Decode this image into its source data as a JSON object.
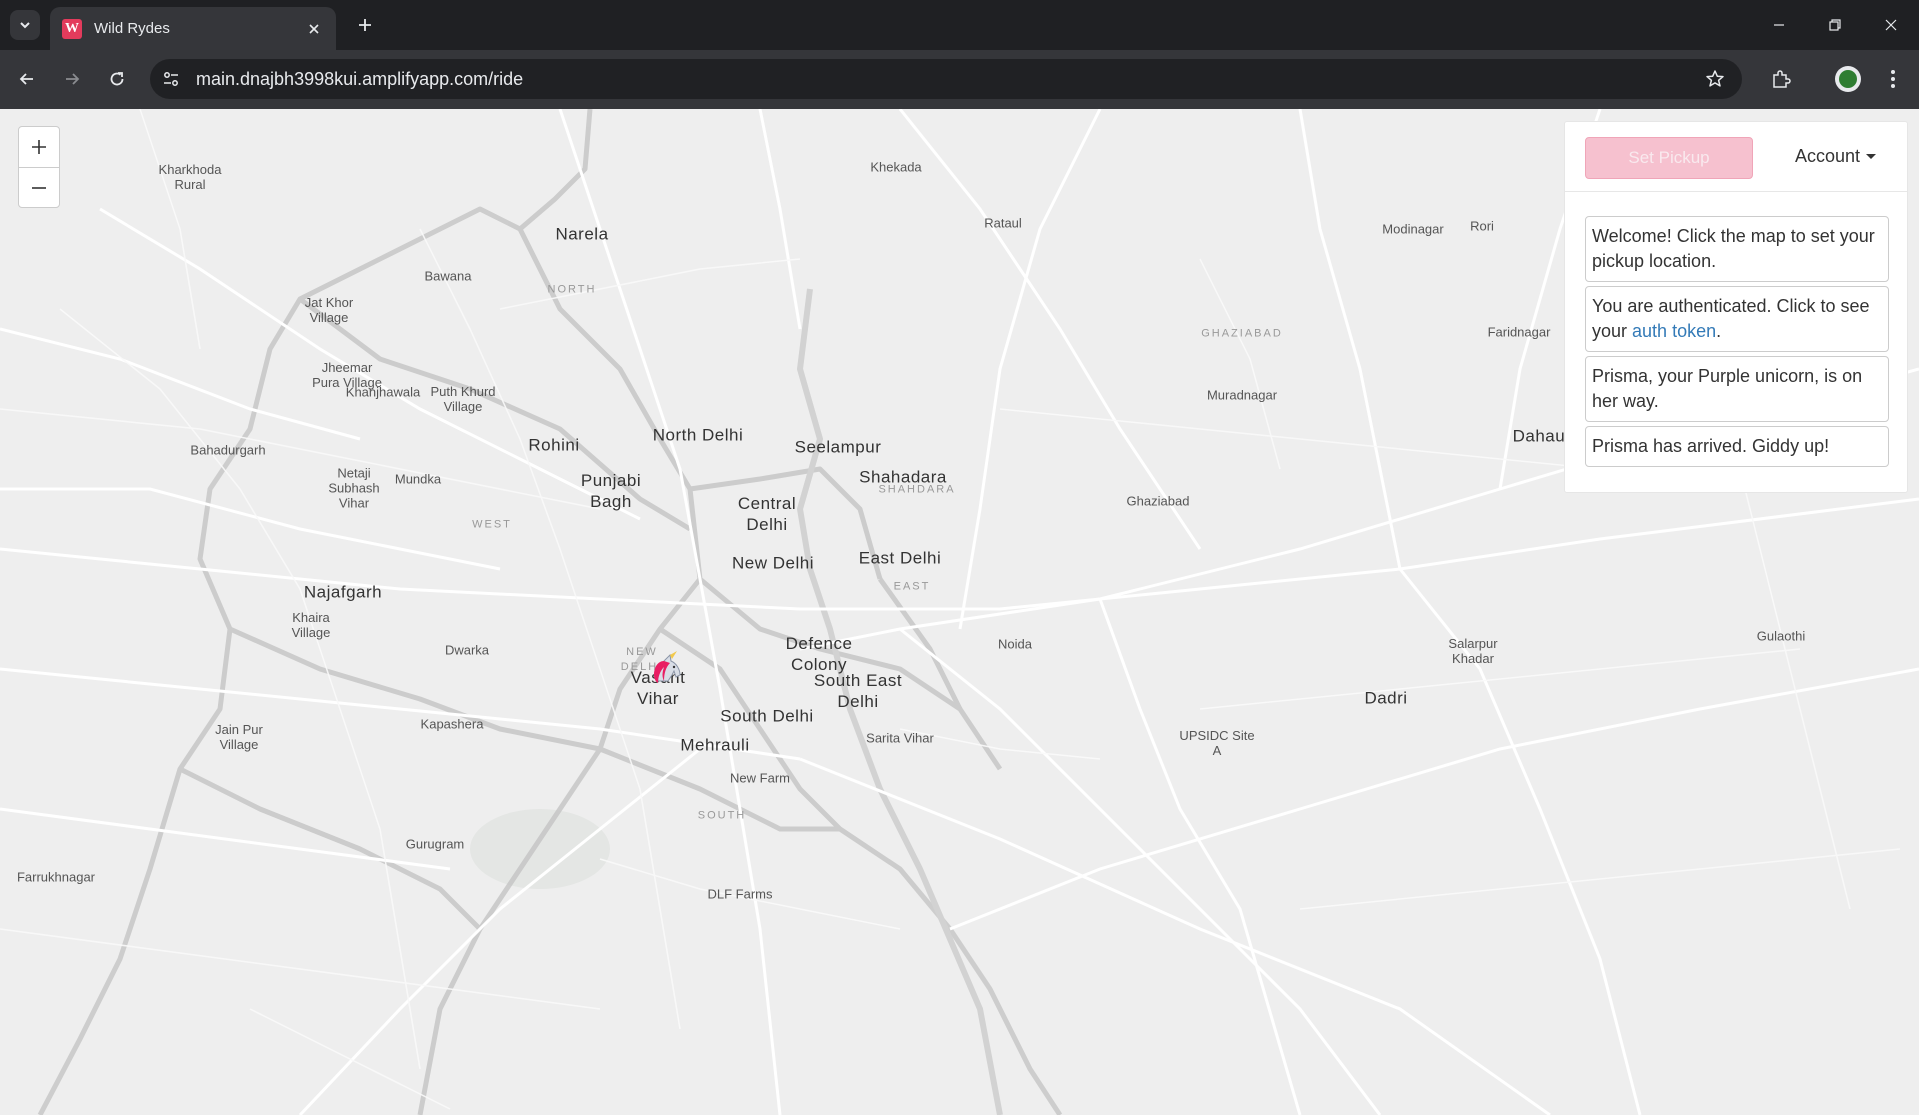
{
  "browser": {
    "tab_title": "Wild Rydes",
    "favicon_letter": "W",
    "url": "main.dnajbh3998kui.amplifyapp.com/ride"
  },
  "map": {
    "zoom_in_label": "+",
    "zoom_out_label": "−",
    "places": {
      "kharkhoda": "Kharkhoda\nRural",
      "khekada": "Khekada",
      "rori": "Rori",
      "rataul": "Rataul",
      "modinagar": "Modinagar",
      "narela": "Narela",
      "bawana": "Bawana",
      "north_district": "NORTH",
      "jat_khor": "Jat Khor\nVillage",
      "puth_khurd": "Puth Khurd\nVillage",
      "ghaziabad_district": "GHAZIABAD",
      "faridnagar": "Faridnagar",
      "jheemar": "Jheemar\nPura Village",
      "khanjhawala": "Khanjhawala",
      "muradnagar": "Muradnagar",
      "rohini": "Rohini",
      "north_delhi": "North Delhi",
      "seelampur": "Seelampur",
      "dahaulana": "Dahaulana",
      "bahadurgarh": "Bahadurgarh",
      "netaji": "Netaji\nSubhash\nVihar",
      "mundka": "Mundka",
      "punjabi_bagh": "Punjabi\nBagh",
      "shahadara": "Shahadara",
      "shahdara_district": "SHAHDARA",
      "central_delhi": "Central\nDelhi",
      "ghaziabad": "Ghaziabad",
      "west_district": "WEST",
      "new_delhi": "New Delhi",
      "east_delhi": "East Delhi",
      "east_district": "EAST",
      "najafgarh": "Najafgarh",
      "khaira": "Khaira\nVillage",
      "dwarka": "Dwarka",
      "defence_colony": "Defence\nColony",
      "noida": "Noida",
      "salarpur": "Salarpur\nKhadar",
      "gulaothi": "Gulaothi",
      "new_delhi_district": "NEW\nDELHI",
      "vasant_vihar": "Vasant\nVihar",
      "south_east_delhi": "South East\nDelhi",
      "dadri": "Dadri",
      "south_delhi": "South Delhi",
      "kapashera": "Kapashera",
      "jain_pur": "Jain Pur\nVillage",
      "mehrauli": "Mehrauli",
      "sarita_vihar": "Sarita Vihar",
      "upsidc": "UPSIDC Site\nA",
      "new_farm": "New Farm",
      "south_district": "SOUTH",
      "gurugram": "Gurugram",
      "farrukhnagar": "Farrukhnagar",
      "dlf_farms": "DLF Farms"
    }
  },
  "panel": {
    "set_pickup_label": "Set Pickup",
    "account_label": "Account",
    "messages": {
      "welcome": "Welcome! Click the map to set your pickup location.",
      "auth_prefix": "You are authenticated. Click to see your ",
      "auth_link": "auth token",
      "auth_suffix": ".",
      "on_way": "Prisma, your Purple unicorn, is on her way.",
      "arrived": "Prisma has arrived. Giddy up!"
    }
  },
  "colors": {
    "accent": "#f6c1cf",
    "link": "#337ab7",
    "map_bg": "#eeeeee"
  }
}
